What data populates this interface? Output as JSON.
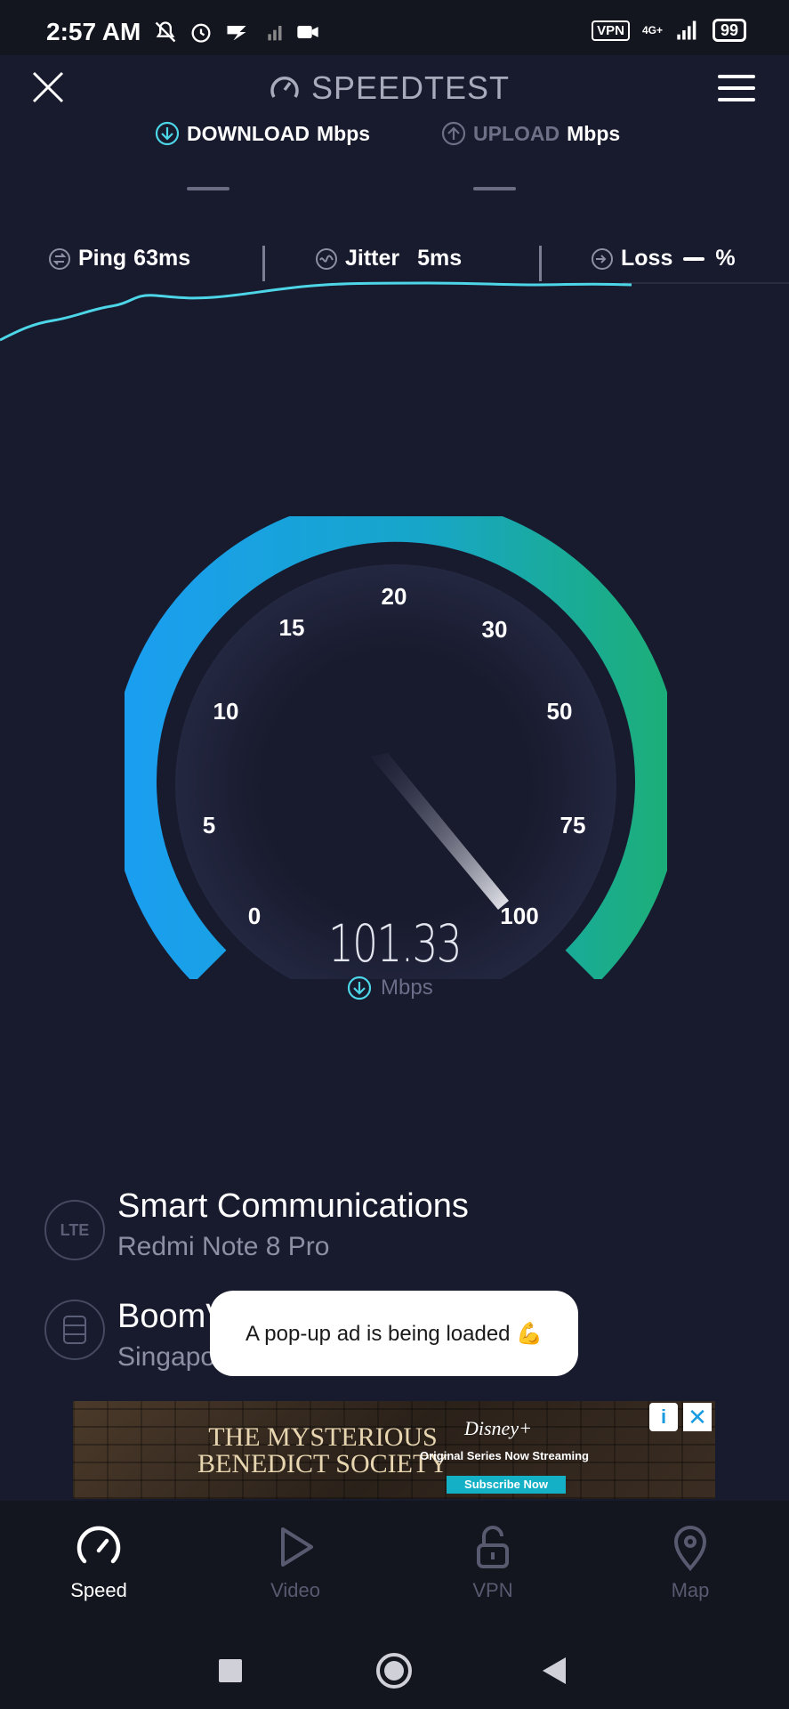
{
  "status_bar": {
    "time": "2:57 AM",
    "vpn": "VPN",
    "network": "4G+",
    "battery": "99",
    "icons_left": [
      "mute-icon",
      "alarm-icon",
      "signal-app-icon",
      "sim-signal-icon",
      "video-icon"
    ]
  },
  "header": {
    "title": "SPEEDTEST",
    "download_label": "DOWNLOAD",
    "download_unit": "Mbps",
    "upload_label": "UPLOAD",
    "upload_unit": "Mbps"
  },
  "stats": {
    "ping_label": "Ping",
    "ping_value": "63ms",
    "jitter_label": "Jitter",
    "jitter_value": "5ms",
    "loss_label": "Loss",
    "loss_unit": "%"
  },
  "gauge": {
    "ticks": [
      "0",
      "5",
      "10",
      "15",
      "20",
      "30",
      "50",
      "75",
      "100"
    ],
    "value": "101.33",
    "unit": "Mbps",
    "colors": {
      "start": "#1a9ef0",
      "end": "#1cae7a"
    }
  },
  "connection": {
    "isp_badge": "LTE",
    "isp_name": "Smart Communications",
    "device": "Redmi Note 8 Pro",
    "server_name": "BoomVM",
    "server_location": "Singapore"
  },
  "toast": {
    "message": "A pop-up ad is being loaded 💪"
  },
  "ad": {
    "brand": "Disney+",
    "title_line1": "THE MYSTERIOUS",
    "title_line2": "BENEDICT SOCIETY",
    "tagline": "Original Series Now Streaming",
    "cta": "Subscribe Now"
  },
  "bottom_nav": {
    "items": [
      {
        "label": "Speed",
        "icon": "speedometer-icon",
        "active": true
      },
      {
        "label": "Video",
        "icon": "play-icon",
        "active": false
      },
      {
        "label": "VPN",
        "icon": "unlock-icon",
        "active": false
      },
      {
        "label": "Map",
        "icon": "map-pin-icon",
        "active": false
      }
    ]
  },
  "colors": {
    "background": "#181a2d",
    "accent": "#4dd6e8",
    "inactive": "#585b70"
  }
}
